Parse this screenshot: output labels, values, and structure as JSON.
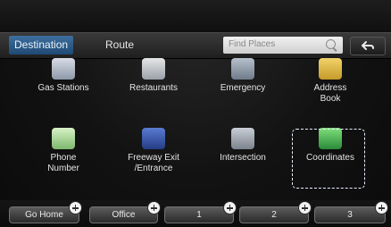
{
  "tabs": {
    "destination": "Destination",
    "route": "Route"
  },
  "search": {
    "placeholder": "Find Places"
  },
  "destination_items": [
    {
      "label": "Gas Stations",
      "icon": "gas-station-icon"
    },
    {
      "label": "Restaurants",
      "icon": "restaurant-icon"
    },
    {
      "label": "Emergency",
      "icon": "emergency-icon"
    },
    {
      "label": "Address\nBook",
      "icon": "address-book-icon"
    },
    {
      "label": "Phone\nNumber",
      "icon": "phone-icon"
    },
    {
      "label": "Freeway Exit\n/Entrance",
      "icon": "freeway-exit-icon"
    },
    {
      "label": "Intersection",
      "icon": "intersection-icon"
    },
    {
      "label": "Coordinates",
      "icon": "coordinates-icon"
    }
  ],
  "bottom_buttons": [
    {
      "label": "Go Home"
    },
    {
      "label": "Office"
    },
    {
      "label": "1"
    },
    {
      "label": "2"
    },
    {
      "label": "3"
    }
  ],
  "colors": {
    "active_tab": "#2f5f8c",
    "focus_outline": "#e9f1ff"
  }
}
